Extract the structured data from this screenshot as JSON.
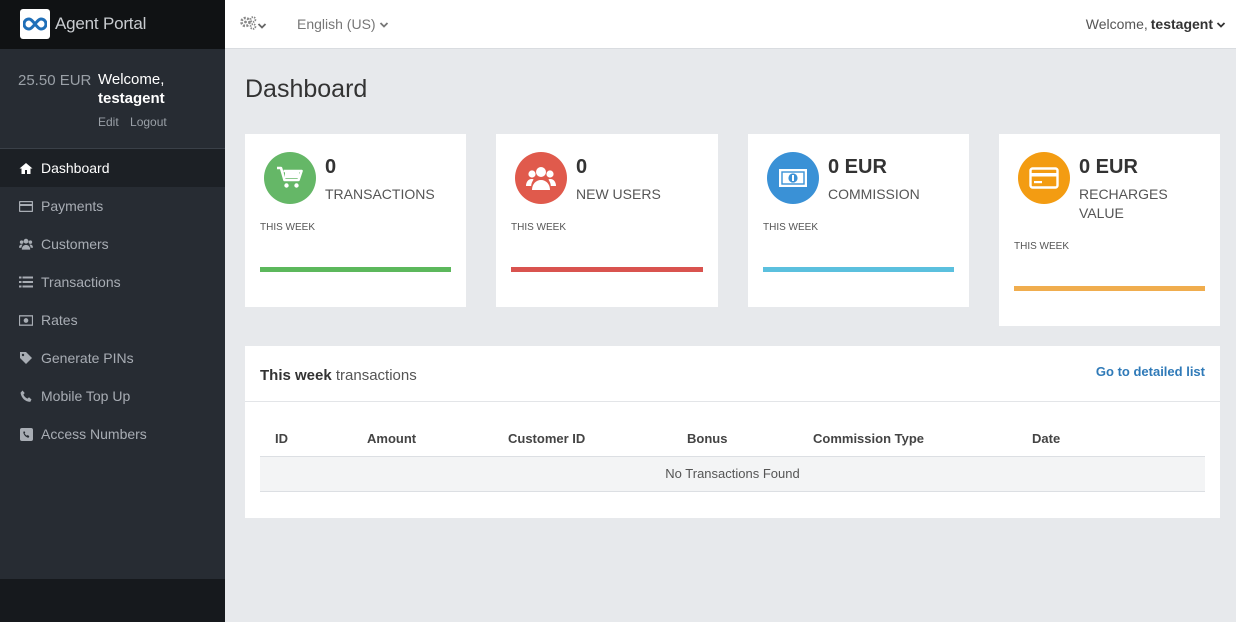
{
  "app": {
    "title": "Agent Portal"
  },
  "sidebar": {
    "balance": "25.50 EUR",
    "welcome": "Welcome,",
    "username": "testagent",
    "edit_label": "Edit",
    "logout_label": "Logout",
    "items": [
      {
        "label": "Dashboard",
        "icon": "home-icon",
        "active": true
      },
      {
        "label": "Payments",
        "icon": "credit-card-icon"
      },
      {
        "label": "Customers",
        "icon": "users-icon"
      },
      {
        "label": "Transactions",
        "icon": "list-icon"
      },
      {
        "label": "Rates",
        "icon": "money-icon"
      },
      {
        "label": "Generate PINs",
        "icon": "tag-icon"
      },
      {
        "label": "Mobile Top Up",
        "icon": "phone-icon"
      },
      {
        "label": "Access Numbers",
        "icon": "phone-square-icon"
      }
    ]
  },
  "topbar": {
    "language": "English (US)",
    "welcome": "Welcome,",
    "username": "testagent"
  },
  "page": {
    "title": "Dashboard"
  },
  "stats": [
    {
      "value": "0",
      "label": "TRANSACTIONS",
      "period": "THIS WEEK",
      "color": "#5cb85c",
      "icon": "cart-icon"
    },
    {
      "value": "0",
      "label": "NEW USERS",
      "period": "THIS WEEK",
      "color": "#d9534f",
      "icon": "users-icon"
    },
    {
      "value": "0 EUR",
      "label": "COMMISSION",
      "period": "THIS WEEK",
      "color": "#5bc0de",
      "icon": "money-icon"
    },
    {
      "value": "0 EUR",
      "label": "RECHARGES VALUE",
      "period": "THIS WEEK",
      "color": "#f0ad4e",
      "icon": "credit-card-icon"
    }
  ],
  "transactions_panel": {
    "title_bold": "This week",
    "title_rest": " transactions",
    "link": "Go to detailed list",
    "columns": [
      "ID",
      "Amount",
      "Customer ID",
      "Bonus",
      "Commission Type",
      "Date"
    ],
    "empty_message": "No Transactions Found"
  },
  "colors": {
    "sidebar_bg": "#272c33",
    "link": "#2f7ab8",
    "icon_green": "#65b767",
    "icon_red": "#e05a4c",
    "icon_blue": "#3a91d6",
    "icon_orange": "#f39c12"
  }
}
